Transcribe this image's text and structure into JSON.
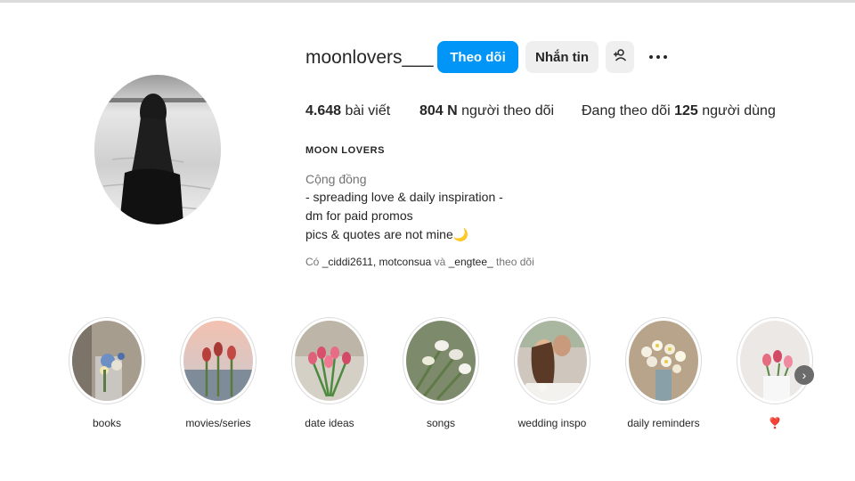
{
  "profile": {
    "username": "moonlovers___",
    "display_name": "MOON LOVERS",
    "category": "Cộng đồng",
    "bio_lines": [
      "- spreading love & daily inspiration -",
      "dm for paid promos",
      "pics & quotes are not mine🌙"
    ],
    "followed_by": {
      "prefix": "Có",
      "accounts": [
        "_ciddi2611",
        "motconsua",
        "_engtee_"
      ],
      "sep": ",",
      "and": "và",
      "suffix": "theo dõi"
    }
  },
  "actions": {
    "follow_label": "Theo dõi",
    "message_label": "Nhắn tin",
    "add_person_icon": "person-plus-icon",
    "more_icon": "ellipsis-icon"
  },
  "stats": {
    "posts_count": "4.648",
    "posts_label": "bài viết",
    "followers_count": "804 N",
    "followers_label": "người theo dõi",
    "following_prefix": "Đang theo dõi",
    "following_count": "125",
    "following_label": "người dùng"
  },
  "highlights": [
    {
      "label": "books"
    },
    {
      "label": "movies/series"
    },
    {
      "label": "date ideas"
    },
    {
      "label": "songs"
    },
    {
      "label": "wedding inspo"
    },
    {
      "label": "daily reminders"
    },
    {
      "label": "❣️"
    }
  ],
  "colors": {
    "accent": "#0095f6",
    "secondary_button": "#efefef",
    "muted_text": "#737373"
  }
}
